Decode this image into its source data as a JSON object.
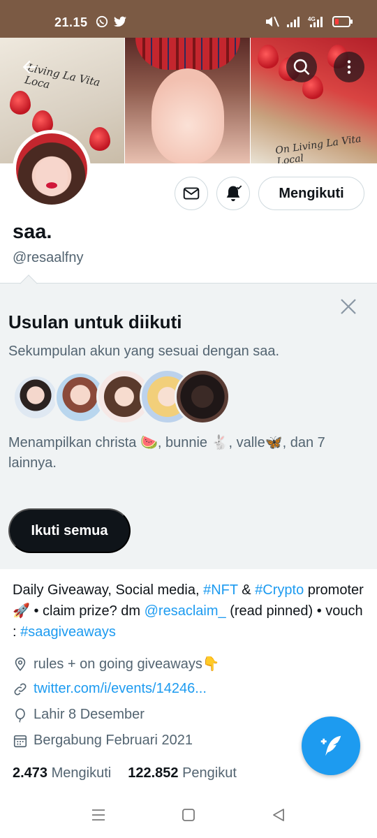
{
  "status_bar": {
    "time": "21.15",
    "network": "4G"
  },
  "header": {
    "back_icon": "arrow-left-icon",
    "search_icon": "search-icon",
    "more_icon": "more-vertical-icon"
  },
  "banner": {
    "newspaper_text_1": "Living La Vita Loca",
    "newspaper_text_2": "On Living La Vita Local"
  },
  "actions": {
    "follow_label": "Mengikuti"
  },
  "profile": {
    "name": "saa.",
    "handle": "@resaalfny"
  },
  "suggestions": {
    "title": "Usulan untuk diikuti",
    "subtitle": "Sekumpulan akun yang sesuai dengan saa.",
    "shown_text": "Menampilkan christa 🍉, bunnie 🐇, valle🦋, dan 7 lainnya.",
    "follow_all_label": "Ikuti semua"
  },
  "bio": {
    "part1": "Daily Giveaway, Social media, ",
    "tag_nft": "#NFT",
    "part2": " & ",
    "tag_crypto": "#Crypto",
    "part3": " promoter🚀 • claim prize? dm ",
    "mention": "@resaclaim_",
    "part4": " (read pinned) • vouch : ",
    "tag_vouch": "#saagiveaways"
  },
  "meta": {
    "location": "rules + on going giveaways👇",
    "website": "twitter.com/i/events/14246...",
    "birthday": "Lahir 8 Desember",
    "joined": "Bergabung Februari 2021"
  },
  "stats": {
    "following_count": "2.473",
    "following_label": "Mengikuti",
    "followers_count": "122.852",
    "followers_label": "Pengikut"
  },
  "colors": {
    "accent": "#1d9bf0",
    "text": "#0f1419",
    "muted": "#536471",
    "status_bar": "#7b5a44"
  }
}
